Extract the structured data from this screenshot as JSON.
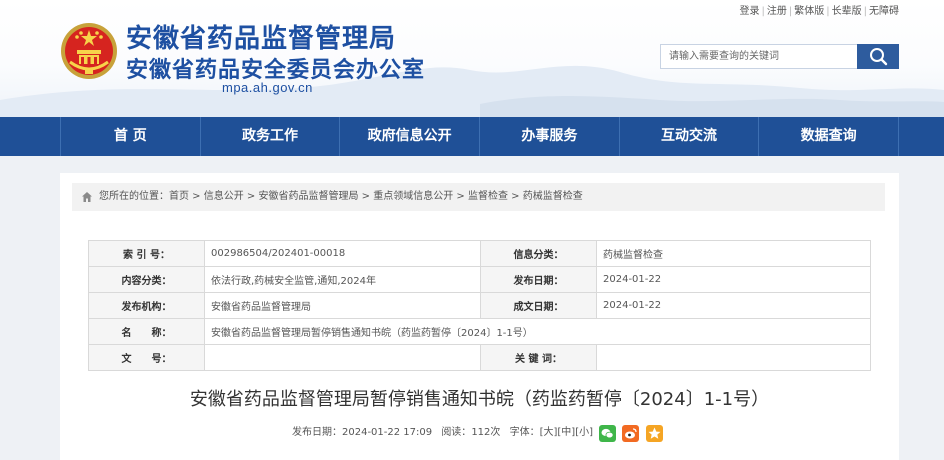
{
  "header": {
    "title_line1": "安徽省药品监督管理局",
    "title_line2": "安徽省药品安全委员会办公室",
    "domain": "mpa.ah.gov.cn"
  },
  "toplinks": [
    "登录",
    "注册",
    "繁体版",
    "长辈版",
    "无障碍"
  ],
  "search": {
    "placeholder": "请输入需要查询的关键词"
  },
  "nav": [
    "首 页",
    "政务工作",
    "政府信息公开",
    "办事服务",
    "互动交流",
    "数据查询"
  ],
  "breadcrumb": {
    "prefix": "您所在的位置：",
    "items": [
      "首页",
      "信息公开",
      "安徽省药品监督管理局",
      "重点领域信息公开",
      "监督检查",
      "药械监督检查"
    ],
    "separator": " > "
  },
  "meta": {
    "index_label": "索 引 号：",
    "index_value": "002986504/202401-00018",
    "category_label": "信息分类：",
    "category_value": "药械监督检查",
    "content_class_label": "内容分类：",
    "content_class_value": "依法行政,药械安全监管,通知,2024年",
    "pub_date_label": "发布日期：",
    "pub_date_value": "2024-01-22",
    "publisher_label": "发布机构：",
    "publisher_value": "安徽省药品监督管理局",
    "created_label": "成文日期：",
    "created_value": "2024-01-22",
    "name_label": "名　　称：",
    "name_value": "安徽省药品监督管理局暂停销售通知书皖（药监药暂停〔2024〕1-1号）",
    "docno_label": "文　　号：",
    "docno_value": "",
    "keywords_label": "关 键 词：",
    "keywords_value": ""
  },
  "doc": {
    "title": "安徽省药品监督管理局暂停销售通知书皖（药监药暂停〔2024〕1-1号）",
    "publish_label": "发布日期：",
    "publish_time": "2024-01-22 17:09",
    "views_label": "阅读：",
    "views": "112次",
    "font_label": "字体：",
    "font_sizes": [
      "[大]",
      "[中]",
      "[小]"
    ]
  },
  "colors": {
    "brand": "#1e50a2",
    "nav": "#1f5097",
    "wechat": "#3fb64a",
    "weibo": "#f26a22",
    "favorite": "#f5a524"
  },
  "icons": [
    "national-emblem-icon",
    "search-icon",
    "home-icon",
    "wechat-icon",
    "weibo-icon",
    "favorite-icon"
  ]
}
